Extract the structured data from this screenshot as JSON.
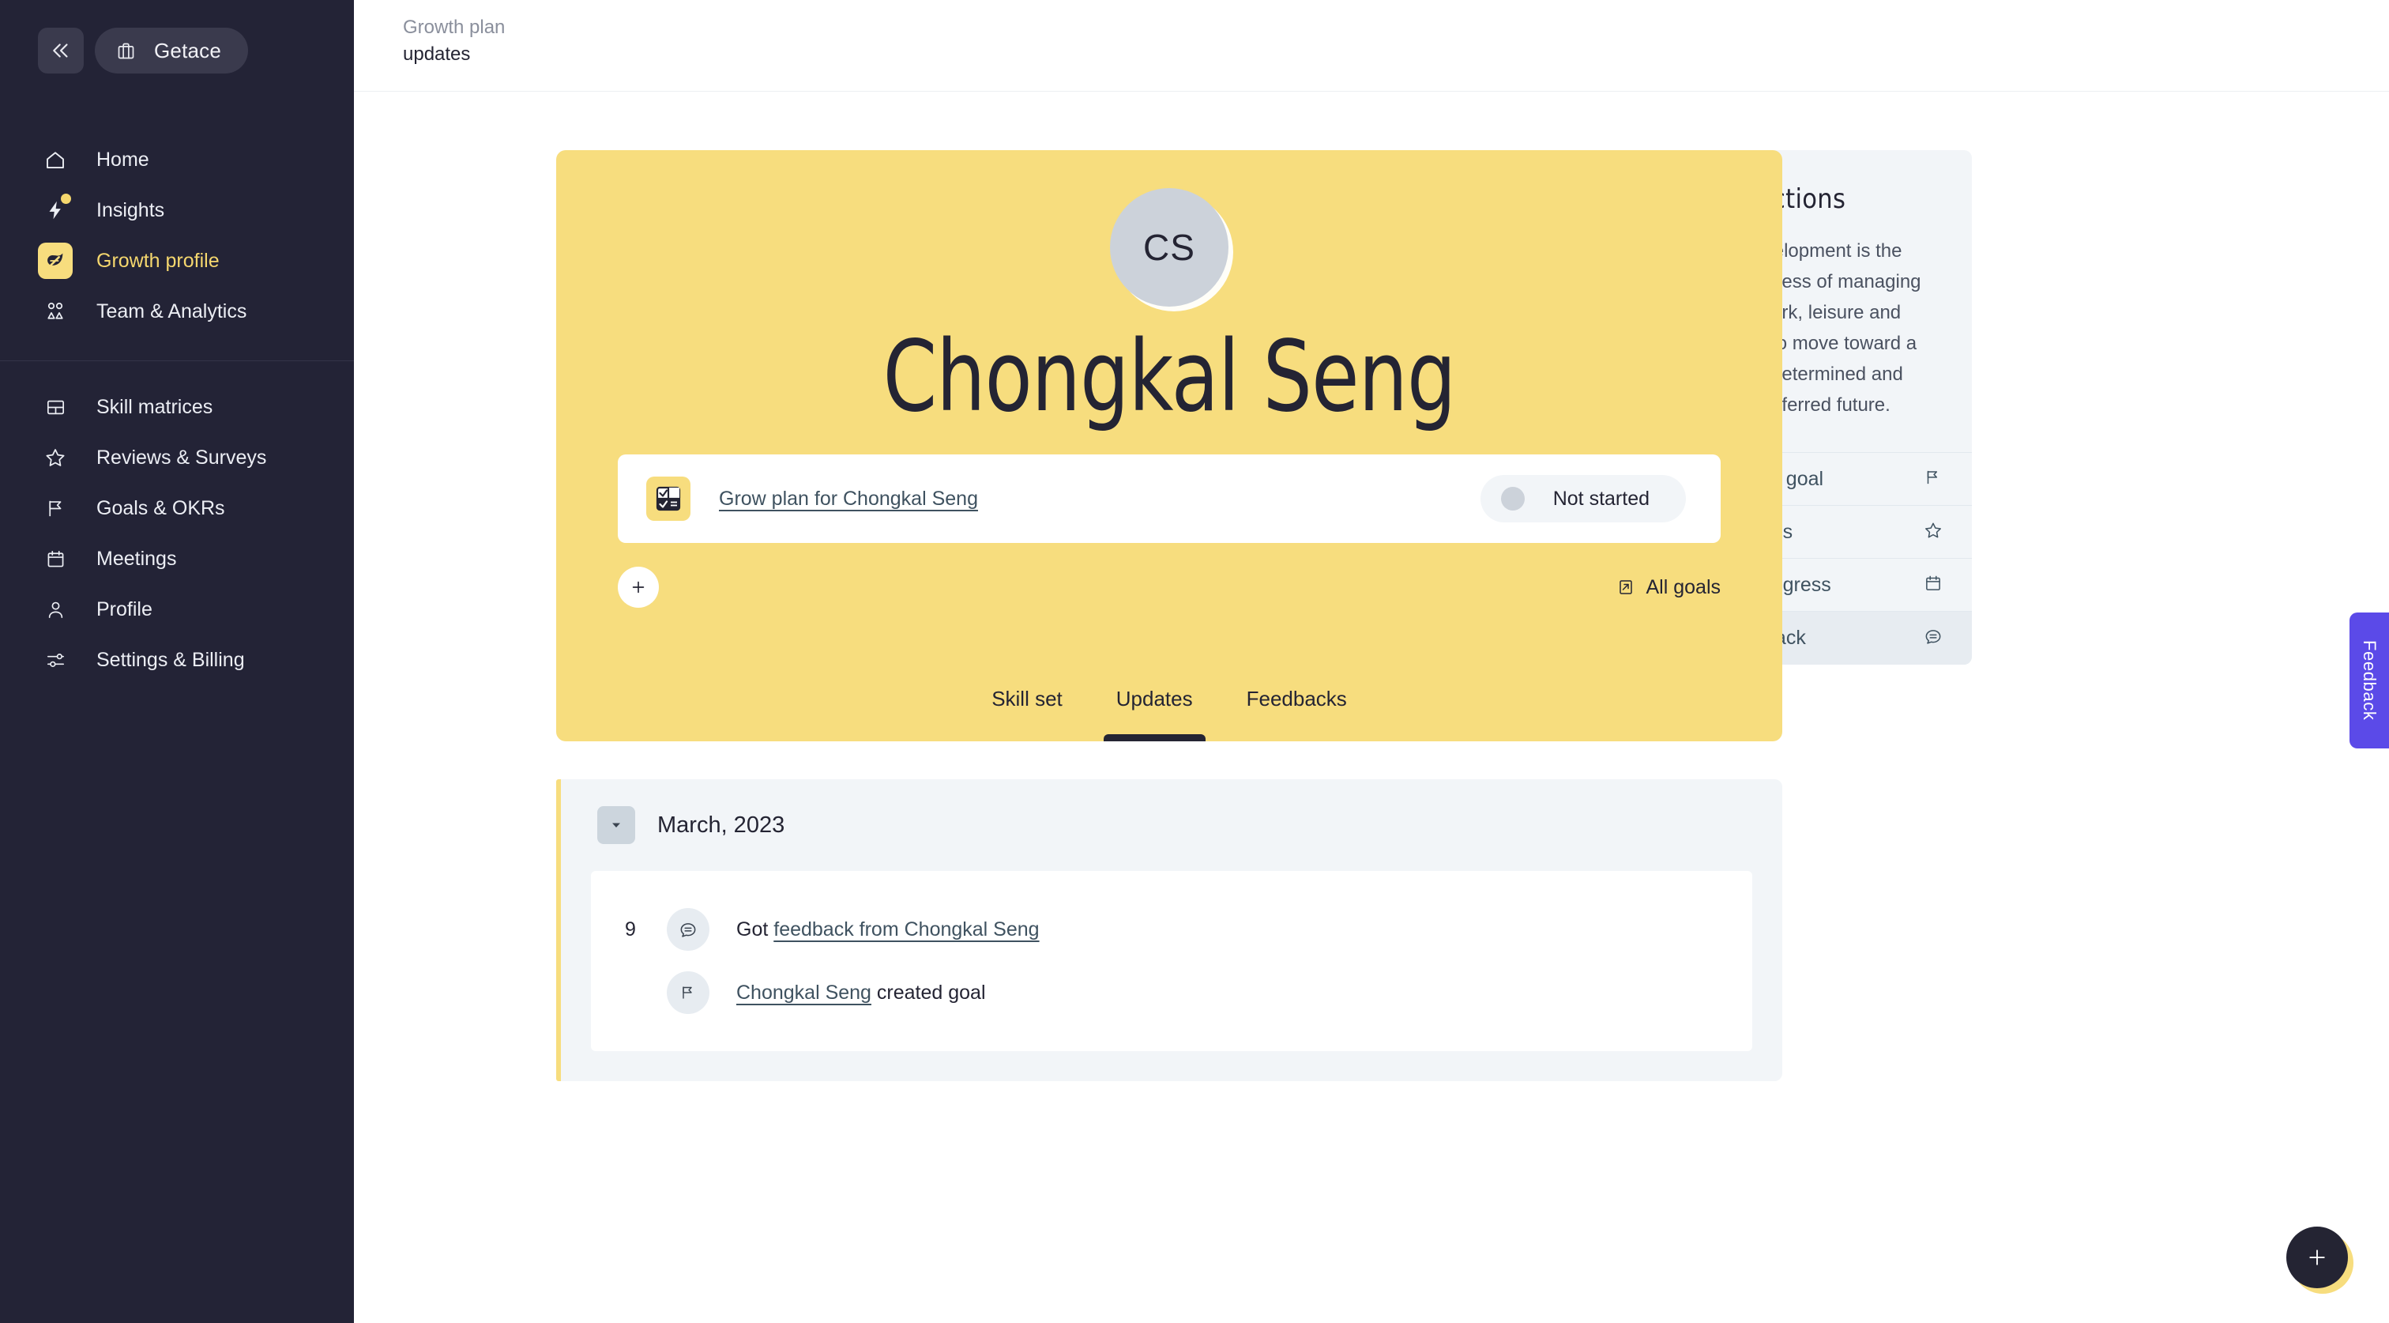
{
  "sidebar": {
    "workspace": "Getace",
    "collapse_label": "«",
    "items": [
      {
        "label": "Home",
        "icon": "home-icon",
        "active": false
      },
      {
        "label": "Insights",
        "icon": "lightning-icon",
        "active": false,
        "badge": true
      },
      {
        "label": "Growth profile",
        "icon": "leaf-icon",
        "active": true
      },
      {
        "label": "Team & Analytics",
        "icon": "team-icon",
        "active": false
      }
    ],
    "items2": [
      {
        "label": "Skill matrices",
        "icon": "layout-icon"
      },
      {
        "label": "Reviews & Surveys",
        "icon": "star-icon"
      },
      {
        "label": "Goals & OKRs",
        "icon": "flag-icon"
      },
      {
        "label": "Meetings",
        "icon": "calendar-icon"
      },
      {
        "label": "Profile",
        "icon": "user-icon"
      },
      {
        "label": "Settings & Billing",
        "icon": "sliders-icon"
      }
    ]
  },
  "topbar": {
    "crumb_top": "Growth plan",
    "crumb_bottom": "updates"
  },
  "hero": {
    "avatar_initials": "CS",
    "name": "Chongkal Seng",
    "goal": {
      "icon": "checklist-icon",
      "link_label": "Grow plan for Chongkal Seng",
      "status": "Not started"
    },
    "add_button": "+",
    "all_goals_label": "All goals",
    "all_goals_icon": "external-link-icon",
    "tabs": [
      {
        "label": "Skill set",
        "active": false
      },
      {
        "label": "Updates",
        "active": true
      },
      {
        "label": "Feedbacks",
        "active": false
      }
    ]
  },
  "timeline": {
    "month": "March, 2023",
    "caret": "▼",
    "rows": [
      {
        "day": "9",
        "icon": "comment-icon",
        "prefix": "Got ",
        "link": "feedback from Chongkal Seng",
        "suffix": ""
      },
      {
        "day": "",
        "icon": "flag-icon",
        "prefix": "",
        "link": "Chongkal Seng",
        "suffix": " created goal"
      }
    ]
  },
  "quick_actions": {
    "title": "Quick actions",
    "description": "Career development is the lifelong process of managing learning, work, leisure and transitions to move toward a personally determined and evolving preferred future.",
    "items": [
      {
        "label": "Assign new goal",
        "icon": "flag-icon",
        "hover": false
      },
      {
        "label": "Review skills",
        "icon": "star-icon",
        "hover": false
      },
      {
        "label": "Discuss progress",
        "icon": "calendar-icon",
        "hover": false
      },
      {
        "label": "Give feedback",
        "icon": "comment-icon",
        "hover": true
      }
    ]
  },
  "feedback_tab": {
    "label": "Feedback"
  },
  "fab": {
    "label": "+"
  },
  "colors": {
    "sidebar_bg": "#232336",
    "accent_yellow": "#f7dd7e",
    "panel_bg": "#f2f5f8",
    "dark": "#242433",
    "link": "#3f5260",
    "feedback_purple": "#5b4ae8"
  }
}
